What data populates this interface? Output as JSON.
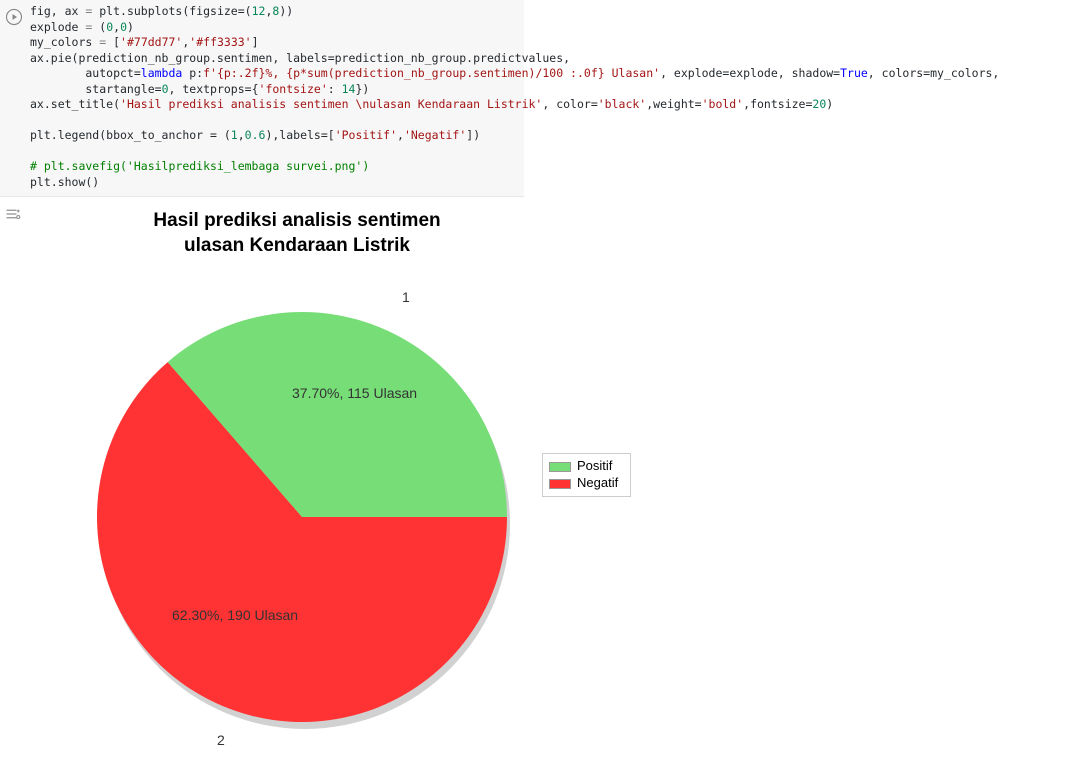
{
  "code": {
    "line1a": "fig, ax ",
    "line1b": " plt.subplots(figsize",
    "line1c": "=(",
    "line1d": "12",
    "line1e": ",",
    "line1f": "8",
    "line1g": "))",
    "line2a": "explode ",
    "line2b": " (",
    "line2c": "0",
    "line2d": ",",
    "line2e": "0",
    "line2f": ")",
    "line3a": "my_colors ",
    "line3b": " [",
    "line3c": "'#77dd77'",
    "line3d": ",",
    "line3e": "'#ff3333'",
    "line3f": "]",
    "line4": "ax.pie(prediction_nb_group.sentimen, labels=prediction_nb_group.predictvalues,",
    "line5a": "        autopct=",
    "line5b": "lambda",
    "line5c": " p:",
    "line5d": "f'{p:.2f}%, {p*sum(prediction_nb_group.sentimen)/100 :.0f} Ulasan'",
    "line5e": ", explode=explode, shadow=",
    "line5f": "True",
    "line5g": ", colors=my_colors,",
    "line6a": "        startangle=",
    "line6b": "0",
    "line6c": ", textprops={",
    "line6d": "'fontsize'",
    "line6e": ": ",
    "line6f": "14",
    "line6g": "})",
    "line7a": "ax.set_title(",
    "line7b": "'Hasil prediksi analisis sentimen \\nulasan Kendaraan Listrik'",
    "line7c": ", color=",
    "line7d": "'black'",
    "line7e": ",weight=",
    "line7f": "'bold'",
    "line7g": ",fontsize=",
    "line7h": "20",
    "line7i": ")",
    "line8": "",
    "line9a": "plt.legend(bbox_to_anchor = (",
    "line9b": "1",
    "line9c": ",",
    "line9d": "0.6",
    "line9e": "),labels=[",
    "line9f": "'Positif'",
    "line9g": ",",
    "line9h": "'Negatif'",
    "line9i": "])",
    "line10": "",
    "line11": "# plt.savefig('Hasilprediksi_lembaga survei.png')",
    "line12": "plt.show()"
  },
  "chart_data": {
    "type": "pie",
    "title": "Hasil prediksi analisis sentimen\nulasan Kendaraan Listrik",
    "startangle": 0,
    "shadow": true,
    "colors": [
      "#77dd77",
      "#ff3333"
    ],
    "series": [
      {
        "name": "Positif",
        "wedge_label": "1",
        "percent": 37.7,
        "count": 115,
        "autopct": "37.70%, 115 Ulasan"
      },
      {
        "name": "Negatif",
        "wedge_label": "2",
        "percent": 62.3,
        "count": 190,
        "autopct": "62.30%, 190 Ulasan"
      }
    ],
    "legend_position": "right"
  },
  "legend": {
    "positif": "Positif",
    "negatif": "Negatif"
  }
}
